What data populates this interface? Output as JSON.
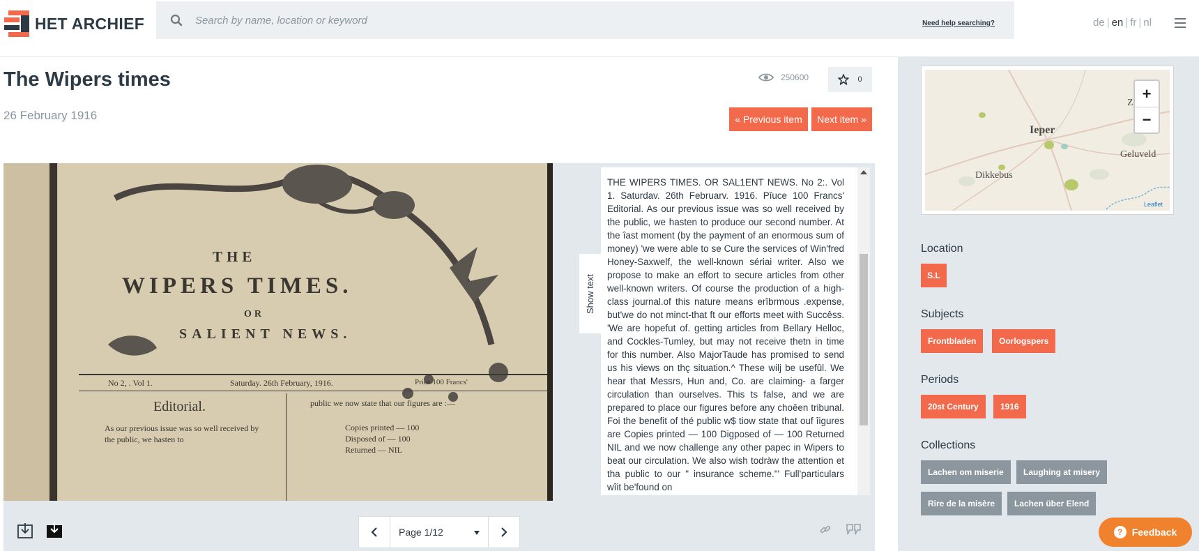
{
  "header": {
    "logo_text": "HET ARCHIEF",
    "search_placeholder": "Search by name, location or keyword",
    "help_link": "Need help searching?",
    "languages": [
      "de",
      "en",
      "fr",
      "nl"
    ],
    "active_language": "en"
  },
  "item": {
    "title": "The Wipers times",
    "date": "26 February 1916",
    "views": "250600",
    "favorites": "0",
    "previous_label": "« Previous item",
    "next_label": "Next item »"
  },
  "scan": {
    "masthead_the": "THE",
    "masthead_title": "WIPERS TIMES.",
    "masthead_or": "OR",
    "masthead_sub": "SALIENT NEWS.",
    "dateline_left": "No 2, . Vol 1.",
    "dateline_mid": "Saturday. 26th February, 1916.",
    "dateline_right": "Price 100 Francs'",
    "editorial": "Editorial.",
    "col1": "As our previous issue was so well received by the public, we hasten to",
    "col2_head": "public we now state that our figures are :—",
    "col2_l1": "Copies printed — 100",
    "col2_l2": "Disposed of — 100",
    "col2_l3": "Returned — NIL"
  },
  "ocr": {
    "show_text_label": "Show text",
    "text": "THE WIPERS TIMES. OR SAL1ENT NEWS. No 2:. Vol 1. Saturdav. 26th Februarv. 1916. Pîuce 100 Francs' Editorial. As our previous issue was so well received by the public, we hasten to produce our second number. At the îast moment (by the payment of an enormous sum of money) 'we were able to se Cure the services of Win'fred Honey-Saxwelf, the well-known sériai writer. Also we propose to make an effort to secure articles from other well-known writers. Of course the production of a high-class journal.of this nature means erîbrmous .expense, but'we do not minct-that ft our efforts meet with Succêss. 'We are hopefut of. getting articles from Bellary Helloc, and Cockles-Tumley, but may not receive thetn in time for this number. Also MajorTaude has promised to send us his views on thç situation.^ These wilj be usefûl. We hear that Messrs, Hun and, Co. are claiming- a farger circulation than ourselves. This ts false, and we are prepared to place our figures before any choêen tribunal. Foi the benefit of thé public w$ tiow state that ouf îigures are Copies printed — 100 Digposed of — 100 Returned NIL and we now challenge any other papec in Wipers to beat our circulation. We also wish todràw the attention et tha public to our \" insurance scheme.'\" Full'particulars wîit be'found on"
  },
  "pager": {
    "page_label": "Page 1/12"
  },
  "sidebar": {
    "map_labels": {
      "ieper": "Ieper",
      "dikkebus": "Dikkebus",
      "geluveld": "Geluveld",
      "zonnebeke": "Zon"
    },
    "leaflet": "Leaflet",
    "zoom_in": "+",
    "zoom_out": "−",
    "location_title": "Location",
    "location_tags": [
      "S.L"
    ],
    "subjects_title": "Subjects",
    "subject_tags": [
      "Frontbladen",
      "Oorlogspers"
    ],
    "periods_title": "Periods",
    "period_tags": [
      "20st Century",
      "1916"
    ],
    "collections_title": "Collections",
    "collection_tags": [
      "Lachen om miserie",
      "Laughing at misery",
      "Rire de la misère",
      "Lachen über Elend"
    ]
  },
  "feedback_label": "Feedback",
  "colors": {
    "accent": "#f26a4b",
    "text": "#2c3a46",
    "sidebar_bg": "#e3e8ec",
    "tag_gray": "#8b969e",
    "feedback": "#f0822e"
  }
}
